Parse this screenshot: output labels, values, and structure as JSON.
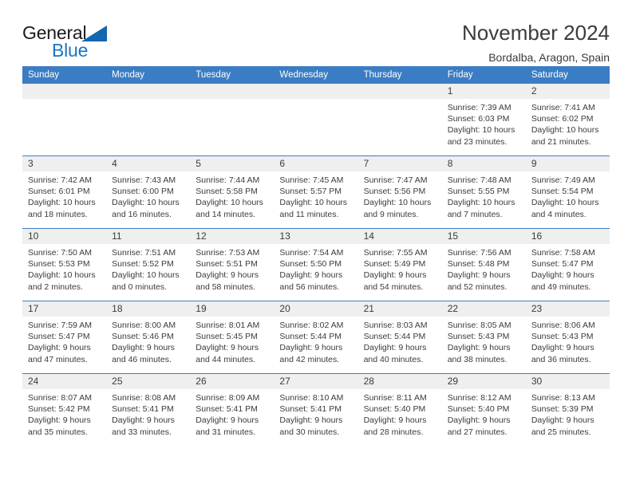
{
  "logo": {
    "word_one": "General",
    "word_two": "Blue",
    "triangle_color": "#1267ae",
    "blue_color": "#1676c8"
  },
  "header": {
    "title": "November 2024",
    "subtitle": "Bordalba, Aragon, Spain"
  },
  "theme": {
    "header_row_bg": "#3b7dc4",
    "daynum_bg": "#efefef",
    "text_color": "#3b3b3b"
  },
  "weekday_headers": [
    "Sunday",
    "Monday",
    "Tuesday",
    "Wednesday",
    "Thursday",
    "Friday",
    "Saturday"
  ],
  "weeks": [
    [
      {
        "day": "",
        "sunrise": "",
        "sunset": "",
        "daylight_1": "",
        "daylight_2": ""
      },
      {
        "day": "",
        "sunrise": "",
        "sunset": "",
        "daylight_1": "",
        "daylight_2": ""
      },
      {
        "day": "",
        "sunrise": "",
        "sunset": "",
        "daylight_1": "",
        "daylight_2": ""
      },
      {
        "day": "",
        "sunrise": "",
        "sunset": "",
        "daylight_1": "",
        "daylight_2": ""
      },
      {
        "day": "",
        "sunrise": "",
        "sunset": "",
        "daylight_1": "",
        "daylight_2": ""
      },
      {
        "day": "1",
        "sunrise": "Sunrise: 7:39 AM",
        "sunset": "Sunset: 6:03 PM",
        "daylight_1": "Daylight: 10 hours",
        "daylight_2": "and 23 minutes."
      },
      {
        "day": "2",
        "sunrise": "Sunrise: 7:41 AM",
        "sunset": "Sunset: 6:02 PM",
        "daylight_1": "Daylight: 10 hours",
        "daylight_2": "and 21 minutes."
      }
    ],
    [
      {
        "day": "3",
        "sunrise": "Sunrise: 7:42 AM",
        "sunset": "Sunset: 6:01 PM",
        "daylight_1": "Daylight: 10 hours",
        "daylight_2": "and 18 minutes."
      },
      {
        "day": "4",
        "sunrise": "Sunrise: 7:43 AM",
        "sunset": "Sunset: 6:00 PM",
        "daylight_1": "Daylight: 10 hours",
        "daylight_2": "and 16 minutes."
      },
      {
        "day": "5",
        "sunrise": "Sunrise: 7:44 AM",
        "sunset": "Sunset: 5:58 PM",
        "daylight_1": "Daylight: 10 hours",
        "daylight_2": "and 14 minutes."
      },
      {
        "day": "6",
        "sunrise": "Sunrise: 7:45 AM",
        "sunset": "Sunset: 5:57 PM",
        "daylight_1": "Daylight: 10 hours",
        "daylight_2": "and 11 minutes."
      },
      {
        "day": "7",
        "sunrise": "Sunrise: 7:47 AM",
        "sunset": "Sunset: 5:56 PM",
        "daylight_1": "Daylight: 10 hours",
        "daylight_2": "and 9 minutes."
      },
      {
        "day": "8",
        "sunrise": "Sunrise: 7:48 AM",
        "sunset": "Sunset: 5:55 PM",
        "daylight_1": "Daylight: 10 hours",
        "daylight_2": "and 7 minutes."
      },
      {
        "day": "9",
        "sunrise": "Sunrise: 7:49 AM",
        "sunset": "Sunset: 5:54 PM",
        "daylight_1": "Daylight: 10 hours",
        "daylight_2": "and 4 minutes."
      }
    ],
    [
      {
        "day": "10",
        "sunrise": "Sunrise: 7:50 AM",
        "sunset": "Sunset: 5:53 PM",
        "daylight_1": "Daylight: 10 hours",
        "daylight_2": "and 2 minutes."
      },
      {
        "day": "11",
        "sunrise": "Sunrise: 7:51 AM",
        "sunset": "Sunset: 5:52 PM",
        "daylight_1": "Daylight: 10 hours",
        "daylight_2": "and 0 minutes."
      },
      {
        "day": "12",
        "sunrise": "Sunrise: 7:53 AM",
        "sunset": "Sunset: 5:51 PM",
        "daylight_1": "Daylight: 9 hours",
        "daylight_2": "and 58 minutes."
      },
      {
        "day": "13",
        "sunrise": "Sunrise: 7:54 AM",
        "sunset": "Sunset: 5:50 PM",
        "daylight_1": "Daylight: 9 hours",
        "daylight_2": "and 56 minutes."
      },
      {
        "day": "14",
        "sunrise": "Sunrise: 7:55 AM",
        "sunset": "Sunset: 5:49 PM",
        "daylight_1": "Daylight: 9 hours",
        "daylight_2": "and 54 minutes."
      },
      {
        "day": "15",
        "sunrise": "Sunrise: 7:56 AM",
        "sunset": "Sunset: 5:48 PM",
        "daylight_1": "Daylight: 9 hours",
        "daylight_2": "and 52 minutes."
      },
      {
        "day": "16",
        "sunrise": "Sunrise: 7:58 AM",
        "sunset": "Sunset: 5:47 PM",
        "daylight_1": "Daylight: 9 hours",
        "daylight_2": "and 49 minutes."
      }
    ],
    [
      {
        "day": "17",
        "sunrise": "Sunrise: 7:59 AM",
        "sunset": "Sunset: 5:47 PM",
        "daylight_1": "Daylight: 9 hours",
        "daylight_2": "and 47 minutes."
      },
      {
        "day": "18",
        "sunrise": "Sunrise: 8:00 AM",
        "sunset": "Sunset: 5:46 PM",
        "daylight_1": "Daylight: 9 hours",
        "daylight_2": "and 46 minutes."
      },
      {
        "day": "19",
        "sunrise": "Sunrise: 8:01 AM",
        "sunset": "Sunset: 5:45 PM",
        "daylight_1": "Daylight: 9 hours",
        "daylight_2": "and 44 minutes."
      },
      {
        "day": "20",
        "sunrise": "Sunrise: 8:02 AM",
        "sunset": "Sunset: 5:44 PM",
        "daylight_1": "Daylight: 9 hours",
        "daylight_2": "and 42 minutes."
      },
      {
        "day": "21",
        "sunrise": "Sunrise: 8:03 AM",
        "sunset": "Sunset: 5:44 PM",
        "daylight_1": "Daylight: 9 hours",
        "daylight_2": "and 40 minutes."
      },
      {
        "day": "22",
        "sunrise": "Sunrise: 8:05 AM",
        "sunset": "Sunset: 5:43 PM",
        "daylight_1": "Daylight: 9 hours",
        "daylight_2": "and 38 minutes."
      },
      {
        "day": "23",
        "sunrise": "Sunrise: 8:06 AM",
        "sunset": "Sunset: 5:43 PM",
        "daylight_1": "Daylight: 9 hours",
        "daylight_2": "and 36 minutes."
      }
    ],
    [
      {
        "day": "24",
        "sunrise": "Sunrise: 8:07 AM",
        "sunset": "Sunset: 5:42 PM",
        "daylight_1": "Daylight: 9 hours",
        "daylight_2": "and 35 minutes."
      },
      {
        "day": "25",
        "sunrise": "Sunrise: 8:08 AM",
        "sunset": "Sunset: 5:41 PM",
        "daylight_1": "Daylight: 9 hours",
        "daylight_2": "and 33 minutes."
      },
      {
        "day": "26",
        "sunrise": "Sunrise: 8:09 AM",
        "sunset": "Sunset: 5:41 PM",
        "daylight_1": "Daylight: 9 hours",
        "daylight_2": "and 31 minutes."
      },
      {
        "day": "27",
        "sunrise": "Sunrise: 8:10 AM",
        "sunset": "Sunset: 5:41 PM",
        "daylight_1": "Daylight: 9 hours",
        "daylight_2": "and 30 minutes."
      },
      {
        "day": "28",
        "sunrise": "Sunrise: 8:11 AM",
        "sunset": "Sunset: 5:40 PM",
        "daylight_1": "Daylight: 9 hours",
        "daylight_2": "and 28 minutes."
      },
      {
        "day": "29",
        "sunrise": "Sunrise: 8:12 AM",
        "sunset": "Sunset: 5:40 PM",
        "daylight_1": "Daylight: 9 hours",
        "daylight_2": "and 27 minutes."
      },
      {
        "day": "30",
        "sunrise": "Sunrise: 8:13 AM",
        "sunset": "Sunset: 5:39 PM",
        "daylight_1": "Daylight: 9 hours",
        "daylight_2": "and 25 minutes."
      }
    ]
  ]
}
